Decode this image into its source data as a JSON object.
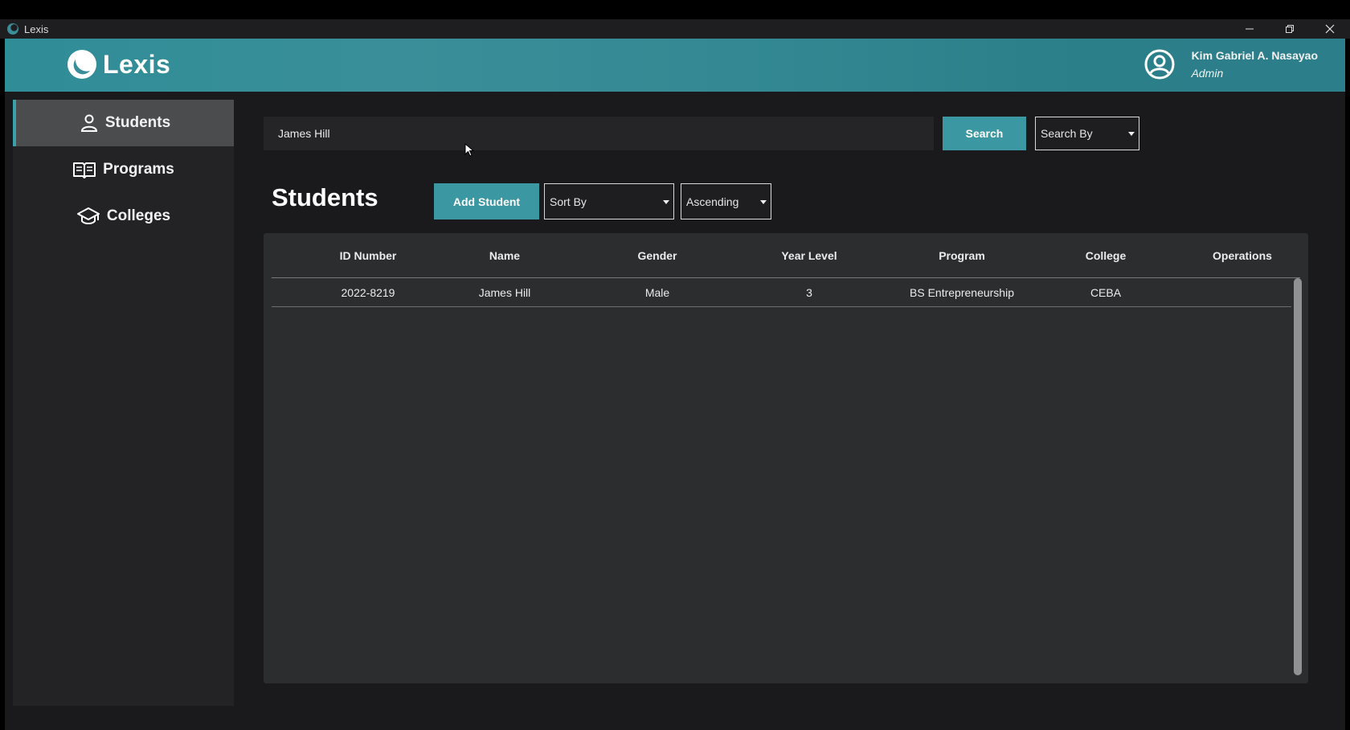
{
  "window": {
    "title": "Lexis"
  },
  "header": {
    "logo_text": "Lexis",
    "user_name": "Kim Gabriel A. Nasayao",
    "user_role": "Admin"
  },
  "sidebar": {
    "items": [
      {
        "label": "Students",
        "icon": "person-icon",
        "active": true
      },
      {
        "label": "Programs",
        "icon": "open-book-icon",
        "active": false
      },
      {
        "label": "Colleges",
        "icon": "graduation-cap-icon",
        "active": false
      }
    ]
  },
  "search": {
    "value": "James Hill",
    "button_label": "Search",
    "search_by": "Search By"
  },
  "main": {
    "title": "Students",
    "add_button_label": "Add Student",
    "sort_by": "Sort By",
    "order": "Ascending"
  },
  "table": {
    "columns": [
      "ID Number",
      "Name",
      "Gender",
      "Year Level",
      "Program",
      "College",
      "Operations"
    ],
    "rows": [
      [
        "2022-8219",
        "James Hill",
        "Male",
        "3",
        "BS Entrepreneurship",
        "CEBA",
        ""
      ]
    ]
  },
  "colors": {
    "accent": "#3b97a1",
    "header_teal": "#338893",
    "background": "#1a1a1c",
    "panel": "#2b2d2f"
  }
}
